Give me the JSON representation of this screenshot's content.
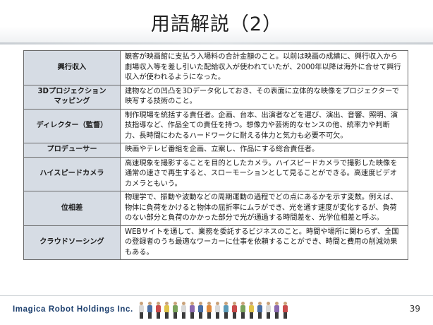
{
  "title": "用語解説（2）",
  "terms": [
    {
      "term": "興行収入",
      "definition": "観客が映画館に支払う入場料の合計金額のこと。以前は映画の成績に、興行収入から劇場収入等を差し引いた配給収入が使われていたが、2000年以降は海外に合せて興行収入が使われるようになった。"
    },
    {
      "term": "3Dプロジェクション\nマッピング",
      "definition": "建物などの凹凸を3Dデータ化しておき、その表面に立体的な映像をプロジェクターで映写する技術のこと。"
    },
    {
      "term": "ディレクター（監督）",
      "definition": "制作現場を統括する責任者。企画、台本、出演者などを選び、演出、音響、照明、演技指導など、作品全ての責任を持つ。想像力や芸術的なセンスの他、統率力や判断力、長時間にわたるハードワークに耐える体力と気力も必要不可欠。"
    },
    {
      "term": "プロデューサー",
      "definition": "映画やテレビ番組を企画、立案し、作品にする総合責任者。"
    },
    {
      "term": "ハイスピードカメラ",
      "definition": "高速現象を撮影することを目的としたカメラ。ハイスピードカメラで撮影した映像を通常の速さで再生すると、スローモーションとして見ることができる。高速度ビデオカメラともいう。"
    },
    {
      "term": "位相差",
      "definition": "物理学で、振動や波動などの周期運動の過程でどの点にあるかを示す変数。例えば、物体に負荷をかけると物体の屈折率にムラができ、光を通す速度が変化するが、負荷のない部分と負荷のかかった部分で光が通過する時間差を、光学位相差と呼ぶ。"
    },
    {
      "term": "クラウドソーシング",
      "definition": "WEBサイトを通して、業務を委託するビジネスのこと。時間や場所に関わらず、全国の登録者のうち最適なワーカーに仕事を依頼することができ、時間と費用の削減効果もある。"
    }
  ],
  "footer": {
    "company": "Imagica Robot Holdings Inc.",
    "page_number": "39"
  },
  "colors": {
    "term_cell_bg": "#d6dce4",
    "company_text": "#1c3f6e",
    "border": "#6b6b6b"
  },
  "people_shirt_colors": [
    "#d9d9d9",
    "#4a6fa5",
    "#c94b4b",
    "#e0c34a",
    "#7aa35b",
    "#d9d9d9",
    "#8b6ab0",
    "#4a6fa5",
    "#e08a3c",
    "#d9d9d9",
    "#5b9bb8",
    "#c94b4b",
    "#7aa35b",
    "#e0c34a",
    "#4a6fa5",
    "#d9d9d9",
    "#8b6ab0",
    "#c94b4b"
  ]
}
